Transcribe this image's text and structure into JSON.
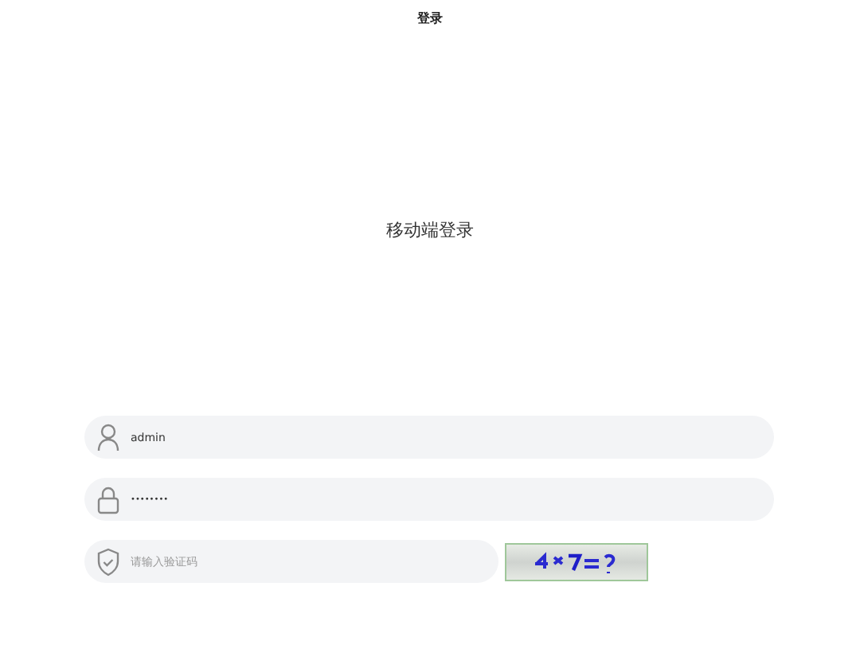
{
  "nav_bar": {
    "title": "登录"
  },
  "heading": "移动端登录",
  "fields": [
    {
      "kind": "user",
      "value": "admin"
    },
    {
      "kind": "password",
      "value": "••••••••"
    },
    {
      "kind": "captcha",
      "placeholder": "请输入验证码"
    }
  ]
}
